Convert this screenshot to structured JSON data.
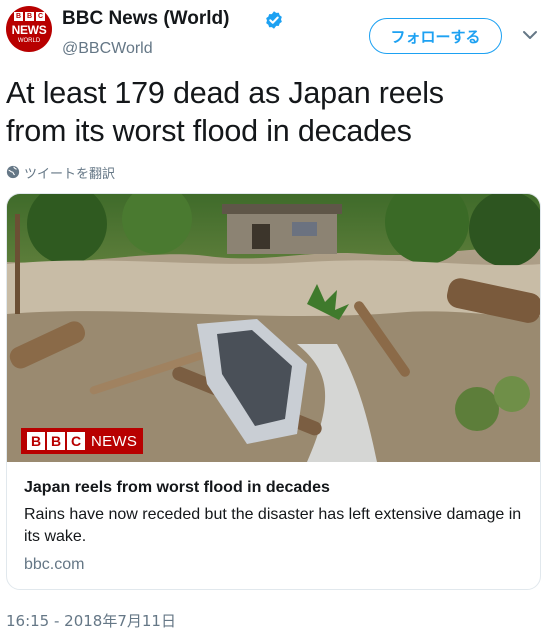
{
  "author": {
    "avatar": {
      "blocks": [
        "B",
        "B",
        "C"
      ],
      "line1": "NEWS",
      "line2": "WORLD"
    },
    "display_name": "BBC News (World)",
    "handle": "@BBCWorld",
    "verified_icon": "verified-badge-icon"
  },
  "follow_label": "フォローする",
  "menu_icon": "chevron-down-icon",
  "tweet": {
    "text_line1": "At least 179 dead as Japan reels",
    "text_line2": "from its worst flood in decades",
    "translate_label": "ツイートを翻訳",
    "timestamp": "16:15 - 2018年7月11日"
  },
  "card": {
    "image_logo": {
      "blocks": [
        "B",
        "B",
        "C"
      ],
      "word": "NEWS"
    },
    "title": "Japan reels from worst flood in decades",
    "description": "Rains have now receded but the disaster has left extensive damage in its wake.",
    "domain": "bbc.com"
  },
  "colors": {
    "accent": "#1da1f2",
    "brand": "#b80000",
    "text": "#14171a",
    "muted": "#657786",
    "border": "#e1e8ed"
  }
}
